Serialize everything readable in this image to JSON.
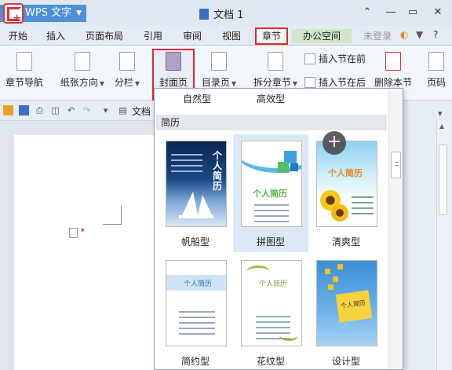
{
  "titlebar": {
    "app_name": "WPS 文字",
    "document_title": "文档 1",
    "buttons": {
      "collapse": "⌃",
      "minimize": "—",
      "maximize": "▭",
      "close": "✕"
    }
  },
  "menu": {
    "tabs": [
      "开始",
      "插入",
      "页面布局",
      "引用",
      "审阅",
      "视图",
      "章节",
      "办公空间",
      "未登录"
    ],
    "active_tab": "章节",
    "help": "?"
  },
  "ribbon": {
    "chapter_nav": "章节导航",
    "orientation": "纸张方向",
    "columns": "分栏",
    "cover_page": "封面页",
    "toc_page": "目录页",
    "split_chapter": "拆分章节",
    "insert_before": "插入节在前",
    "insert_after": "插入节在后",
    "delete_section": "删除本节",
    "page_code": "页码"
  },
  "quickbar": {
    "doc_tab": "文档"
  },
  "gallery": {
    "top_labels": [
      "自然型",
      "高效型"
    ],
    "section": "简历",
    "tiles": [
      {
        "label": "帆船型",
        "thumb_title": "个人简历"
      },
      {
        "label": "拼图型",
        "thumb_title": "个人简历"
      },
      {
        "label": "清爽型",
        "thumb_title": "个人简历"
      },
      {
        "label": "简约型",
        "thumb_title": "个人简历"
      },
      {
        "label": "花纹型",
        "thumb_title": "个人简历"
      },
      {
        "label": "设计型",
        "thumb_title": "个人简历"
      }
    ],
    "hovered": "拼图型"
  },
  "colors": {
    "accent_red": "#e0282e",
    "app_blue": "#4f8fd8",
    "office_green": "#cfe6c8",
    "hover_blue": "#dce8f6"
  }
}
